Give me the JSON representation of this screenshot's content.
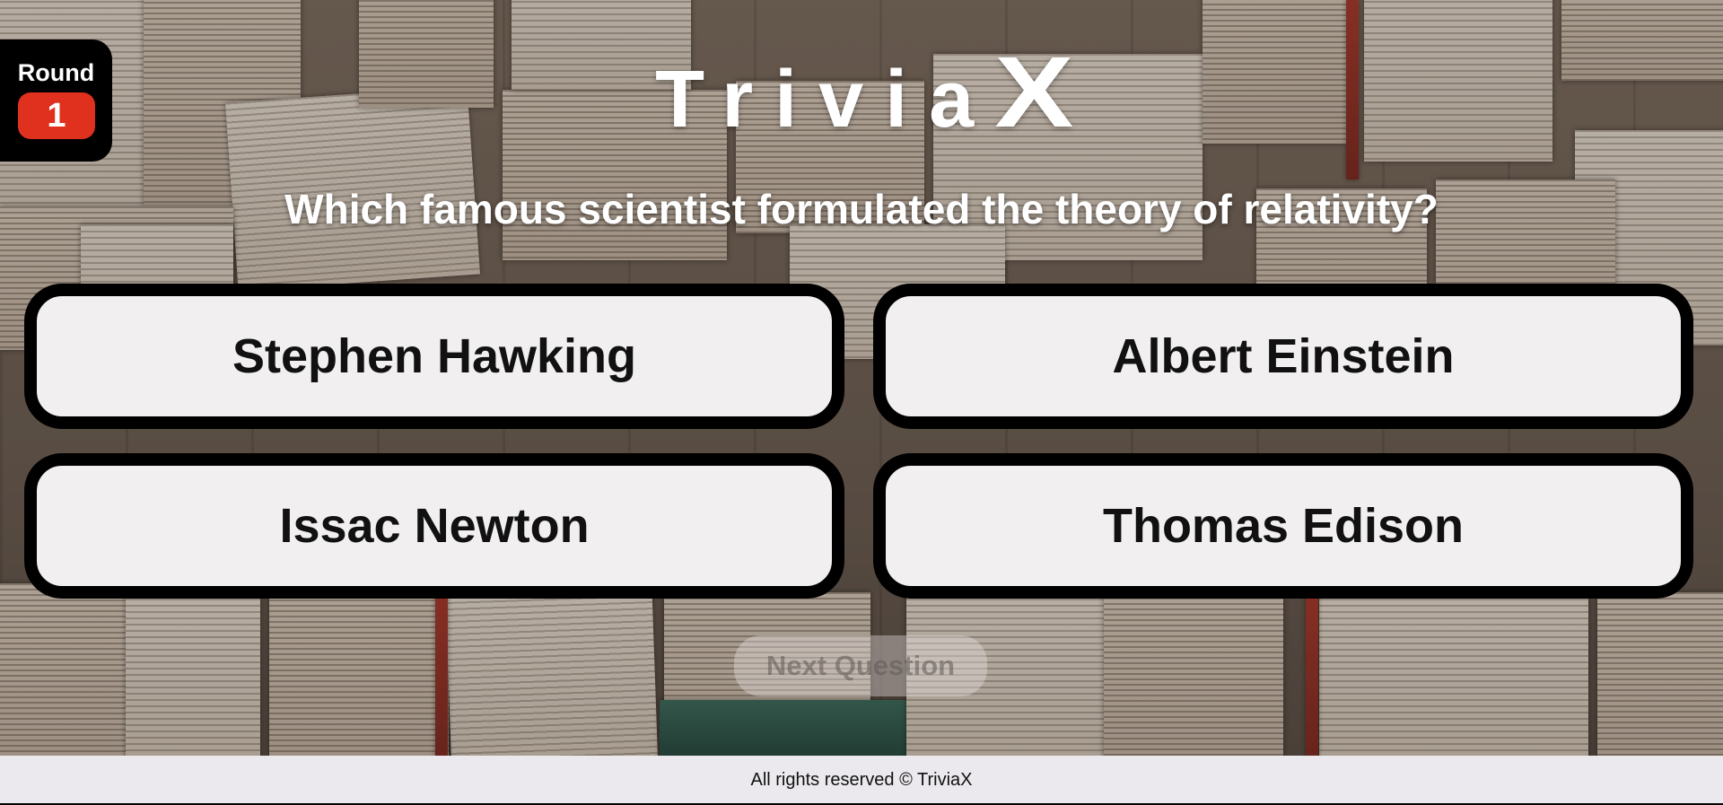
{
  "round": {
    "label": "Round",
    "number": "1"
  },
  "logo": {
    "word": "Trivia",
    "x": "X"
  },
  "question": {
    "text": "Which famous scientist formulated the theory of relativity?"
  },
  "answers": [
    {
      "label": "Stephen Hawking"
    },
    {
      "label": "Albert Einstein"
    },
    {
      "label": "Issac Newton"
    },
    {
      "label": "Thomas Edison"
    }
  ],
  "next_button": {
    "label": "Next Question",
    "enabled": false
  },
  "footer": {
    "text": "All rights reserved © TriviaX"
  },
  "colors": {
    "round_badge": "#e0301e",
    "answer_background": "#f1eff0",
    "answer_border": "#000000",
    "footer_background": "#ebe9ed"
  }
}
